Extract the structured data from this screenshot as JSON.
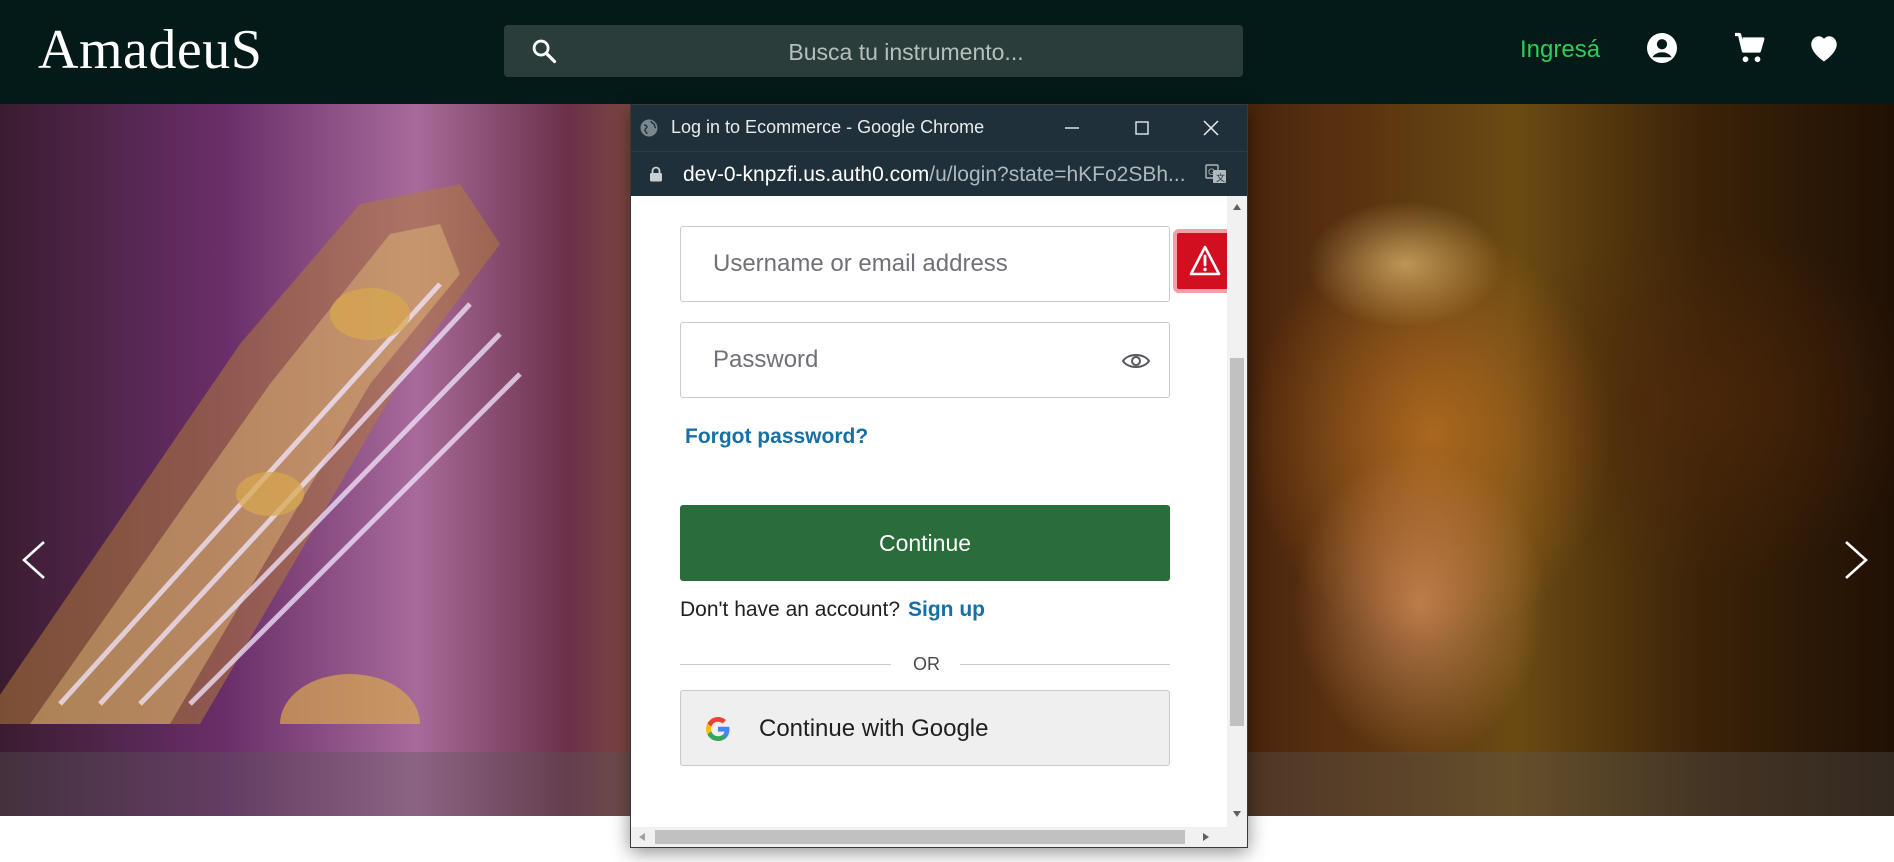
{
  "header": {
    "logo": "AmadeuS",
    "search_placeholder": "Busca tu instrumento...",
    "login_label": "Ingresá",
    "icons": [
      "search-icon",
      "account-icon",
      "cart-icon",
      "heart-icon"
    ],
    "login_color": "#2fcc5b",
    "background": "#041a18"
  },
  "carousel": {
    "icons": [
      "chevron-left-icon",
      "chevron-right-icon"
    ]
  },
  "popup": {
    "window_title": "Log in to Ecommerce - Google Chrome",
    "url_host": "dev-0-knpzfi.us.auth0.com",
    "url_path": "/u/login?state=hKFo2SBh...",
    "username_placeholder": "Username or email address",
    "password_placeholder": "Password",
    "forgot_label": "Forgot password?",
    "continue_label": "Continue",
    "no_account_text": "Don't have an account?",
    "signup_label": "Sign up",
    "or_text": "OR",
    "google_label": "Continue with Google",
    "accent_color": "#2a6d3a",
    "link_color": "#1670a6",
    "error_color": "#d10f21"
  }
}
